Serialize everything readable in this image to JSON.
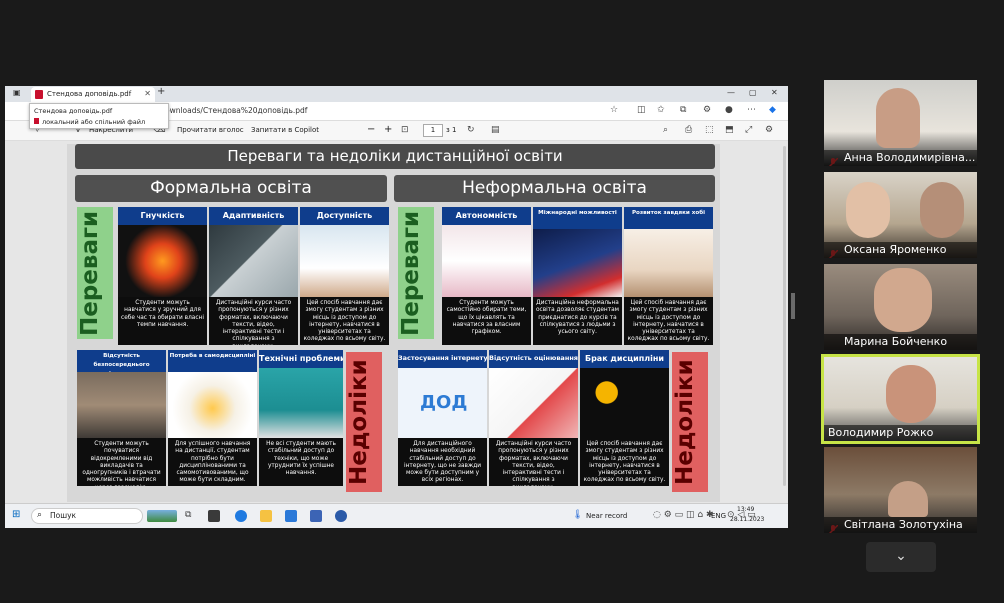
{
  "browser": {
    "tab_title": "Стендова доповідь.pdf",
    "new_tab": "+",
    "url": "ownloads/Стендова%20доповідь.pdf",
    "tooltip_line1": "Стендова доповідь.pdf",
    "tooltip_line2": "локальний або спільний файл"
  },
  "pdf_toolbar": {
    "draw_label": "Накреслити",
    "read_aloud": "Прочитати вголос",
    "ask_copilot": "Запитати в Copilot",
    "zoom_out": "−",
    "zoom_in": "+",
    "page_current": "1",
    "page_total": "з 1"
  },
  "slide": {
    "title": "Переваги та недоліки дистанційної освіти",
    "formal_header": "Формальна освіта",
    "informal_header": "Неформальна освіта",
    "advantages": "Переваги",
    "disadvantages": "Недоліки",
    "formal_adv": [
      {
        "title": "Гнучкість",
        "text": "Студенти можуть навчатися у зручний для себе час та обирати власні темпи навчання."
      },
      {
        "title": "Адаптивність",
        "text": "Дистанційні курси часто пропонуються у різних форматах, включаючи тексти, відео, інтерактивні тести і спілкування з викладачами."
      },
      {
        "title": "Доступність",
        "text": "Цей спосіб навчання дає змогу студентам з різних місць із доступом до інтернету, навчатися в університетах та коледжах по всьому світу."
      }
    ],
    "informal_adv": [
      {
        "title": "Автономність",
        "text": "Студенти можуть самостійно обирати теми, що їх цікавлять та навчатися за власним графіком."
      },
      {
        "title": "Міжнародні можливості",
        "text": "Дистанційна неформальна освіта дозволяє студентам приєднатися до курсів та спілкуватися з людьми з усього світу."
      },
      {
        "title": "Розвиток завдяки хобі",
        "text": "Цей спосіб навчання дає змогу студентам з різних місць із доступом до інтернету, навчатися в університетах та коледжах по всьому світу."
      }
    ],
    "formal_dis": [
      {
        "title": "Відсутність безпосереднього спілкування",
        "text": "Студенти можуть почуватися відокремленими від викладачів та одногрупників і втрачати можливість навчатися через взаємодію."
      },
      {
        "title": "Потреба в самодисципліні",
        "text": "Для успішного навчання на дистанції, студентам потрібно бути дисциплінованими та самомотивованими, що може бути складним."
      },
      {
        "title": "Технічні проблеми",
        "text": "Не всі студенти мають стабільний доступ до техніки, що може утруднити їх успішне навчання."
      }
    ],
    "informal_dis": [
      {
        "title": "Застосування інтернету",
        "text": "Для дистанційного навчання необхідний стабільний доступ до інтернету, що не завжди може бути доступним у всіх регіонах."
      },
      {
        "title": "Відсутність оцінювання",
        "text": "Дистанційні курси часто пропонуються у різних форматах, включаючи тексти, відео, інтерактивні тести і спілкування з викладачами."
      },
      {
        "title": "Брак дисципліни",
        "text": "Цей спосіб навчання дає змогу студентам з різних місць із доступом до інтернету, навчатися в університетах та коледжах по всьому світу."
      }
    ],
    "dod_label": "ДОД"
  },
  "taskbar": {
    "search": "Пошук",
    "weather": "Near record",
    "lang": "ENG",
    "time": "13:49",
    "date": "28.11.2023"
  },
  "participants": [
    {
      "name": "Анна Володимирівна..."
    },
    {
      "name": "Оксана  Яроменко"
    },
    {
      "name": "Марина Бойченко"
    },
    {
      "name": "Володимир Рожко"
    },
    {
      "name": "Світлана Золотухіна"
    }
  ],
  "colors": {
    "accent_active": "#c7e447",
    "card_header": "#0f3d8c",
    "adv_green": "#8fd18b",
    "dis_red": "#e06060"
  }
}
